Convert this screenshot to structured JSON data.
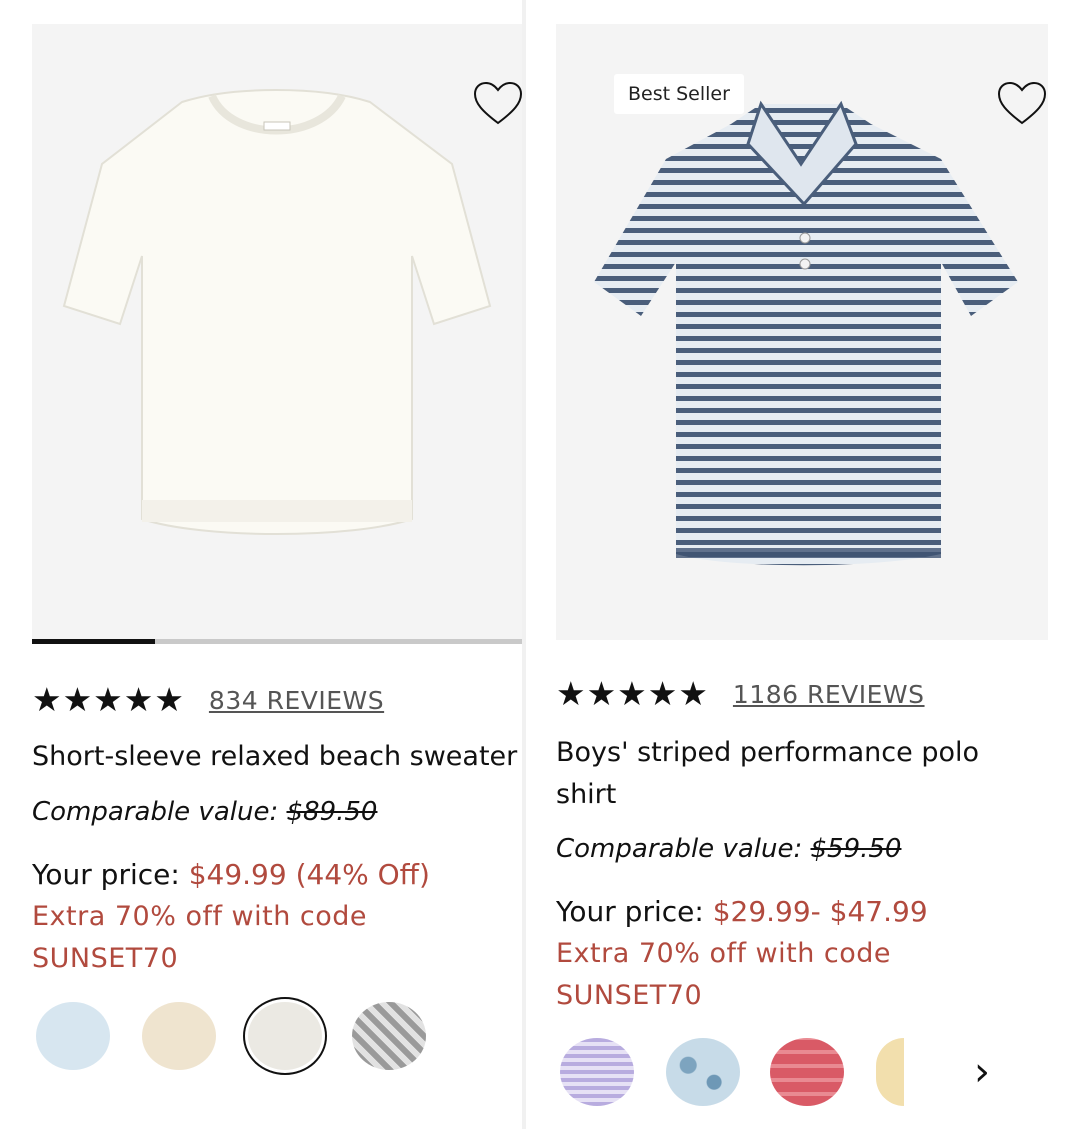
{
  "products": [
    {
      "badge": "",
      "rating": "★★★★★",
      "reviews": "834 REVIEWS",
      "name": "Short-sleeve relaxed beach sweater",
      "comparable_label": "Comparable value:",
      "comparable_price": "$89.50",
      "price_label": "Your price:",
      "price_value": "$49.99 (44% Off)",
      "promo_line1": "Extra 70% off with code",
      "promo_line2": "SUNSET70",
      "image_progress": 0.25,
      "swatches": [
        {
          "name": "light-blue",
          "color": "#d7e6f0"
        },
        {
          "name": "beige",
          "color": "#efe4cf"
        },
        {
          "name": "ivory",
          "color": "#ebe9e3",
          "selected": true
        },
        {
          "name": "grey-pattern",
          "color": "#b7b7b7"
        }
      ]
    },
    {
      "badge": "Best Seller",
      "rating": "★★★★★",
      "reviews": "1186 REVIEWS",
      "name": "Boys' striped performance polo shirt",
      "comparable_label": "Comparable value:",
      "comparable_price": "$59.50",
      "price_label": "Your price:",
      "price_value": "$29.99- $47.99",
      "promo_line1": "Extra 70% off with code",
      "promo_line2": "SUNSET70",
      "swatches": [
        {
          "name": "lavender-gingham",
          "color": "#cdc6ea"
        },
        {
          "name": "blue-floral",
          "color": "#b7cfe0"
        },
        {
          "name": "red-shark",
          "color": "#d9606a"
        },
        {
          "name": "yellow-floral",
          "color": "#f2dfad"
        }
      ],
      "more_icon": "chevron-right-icon"
    }
  ],
  "colors": {
    "accent_red": "#b14a3e",
    "image_bg": "#f4f4f4"
  }
}
